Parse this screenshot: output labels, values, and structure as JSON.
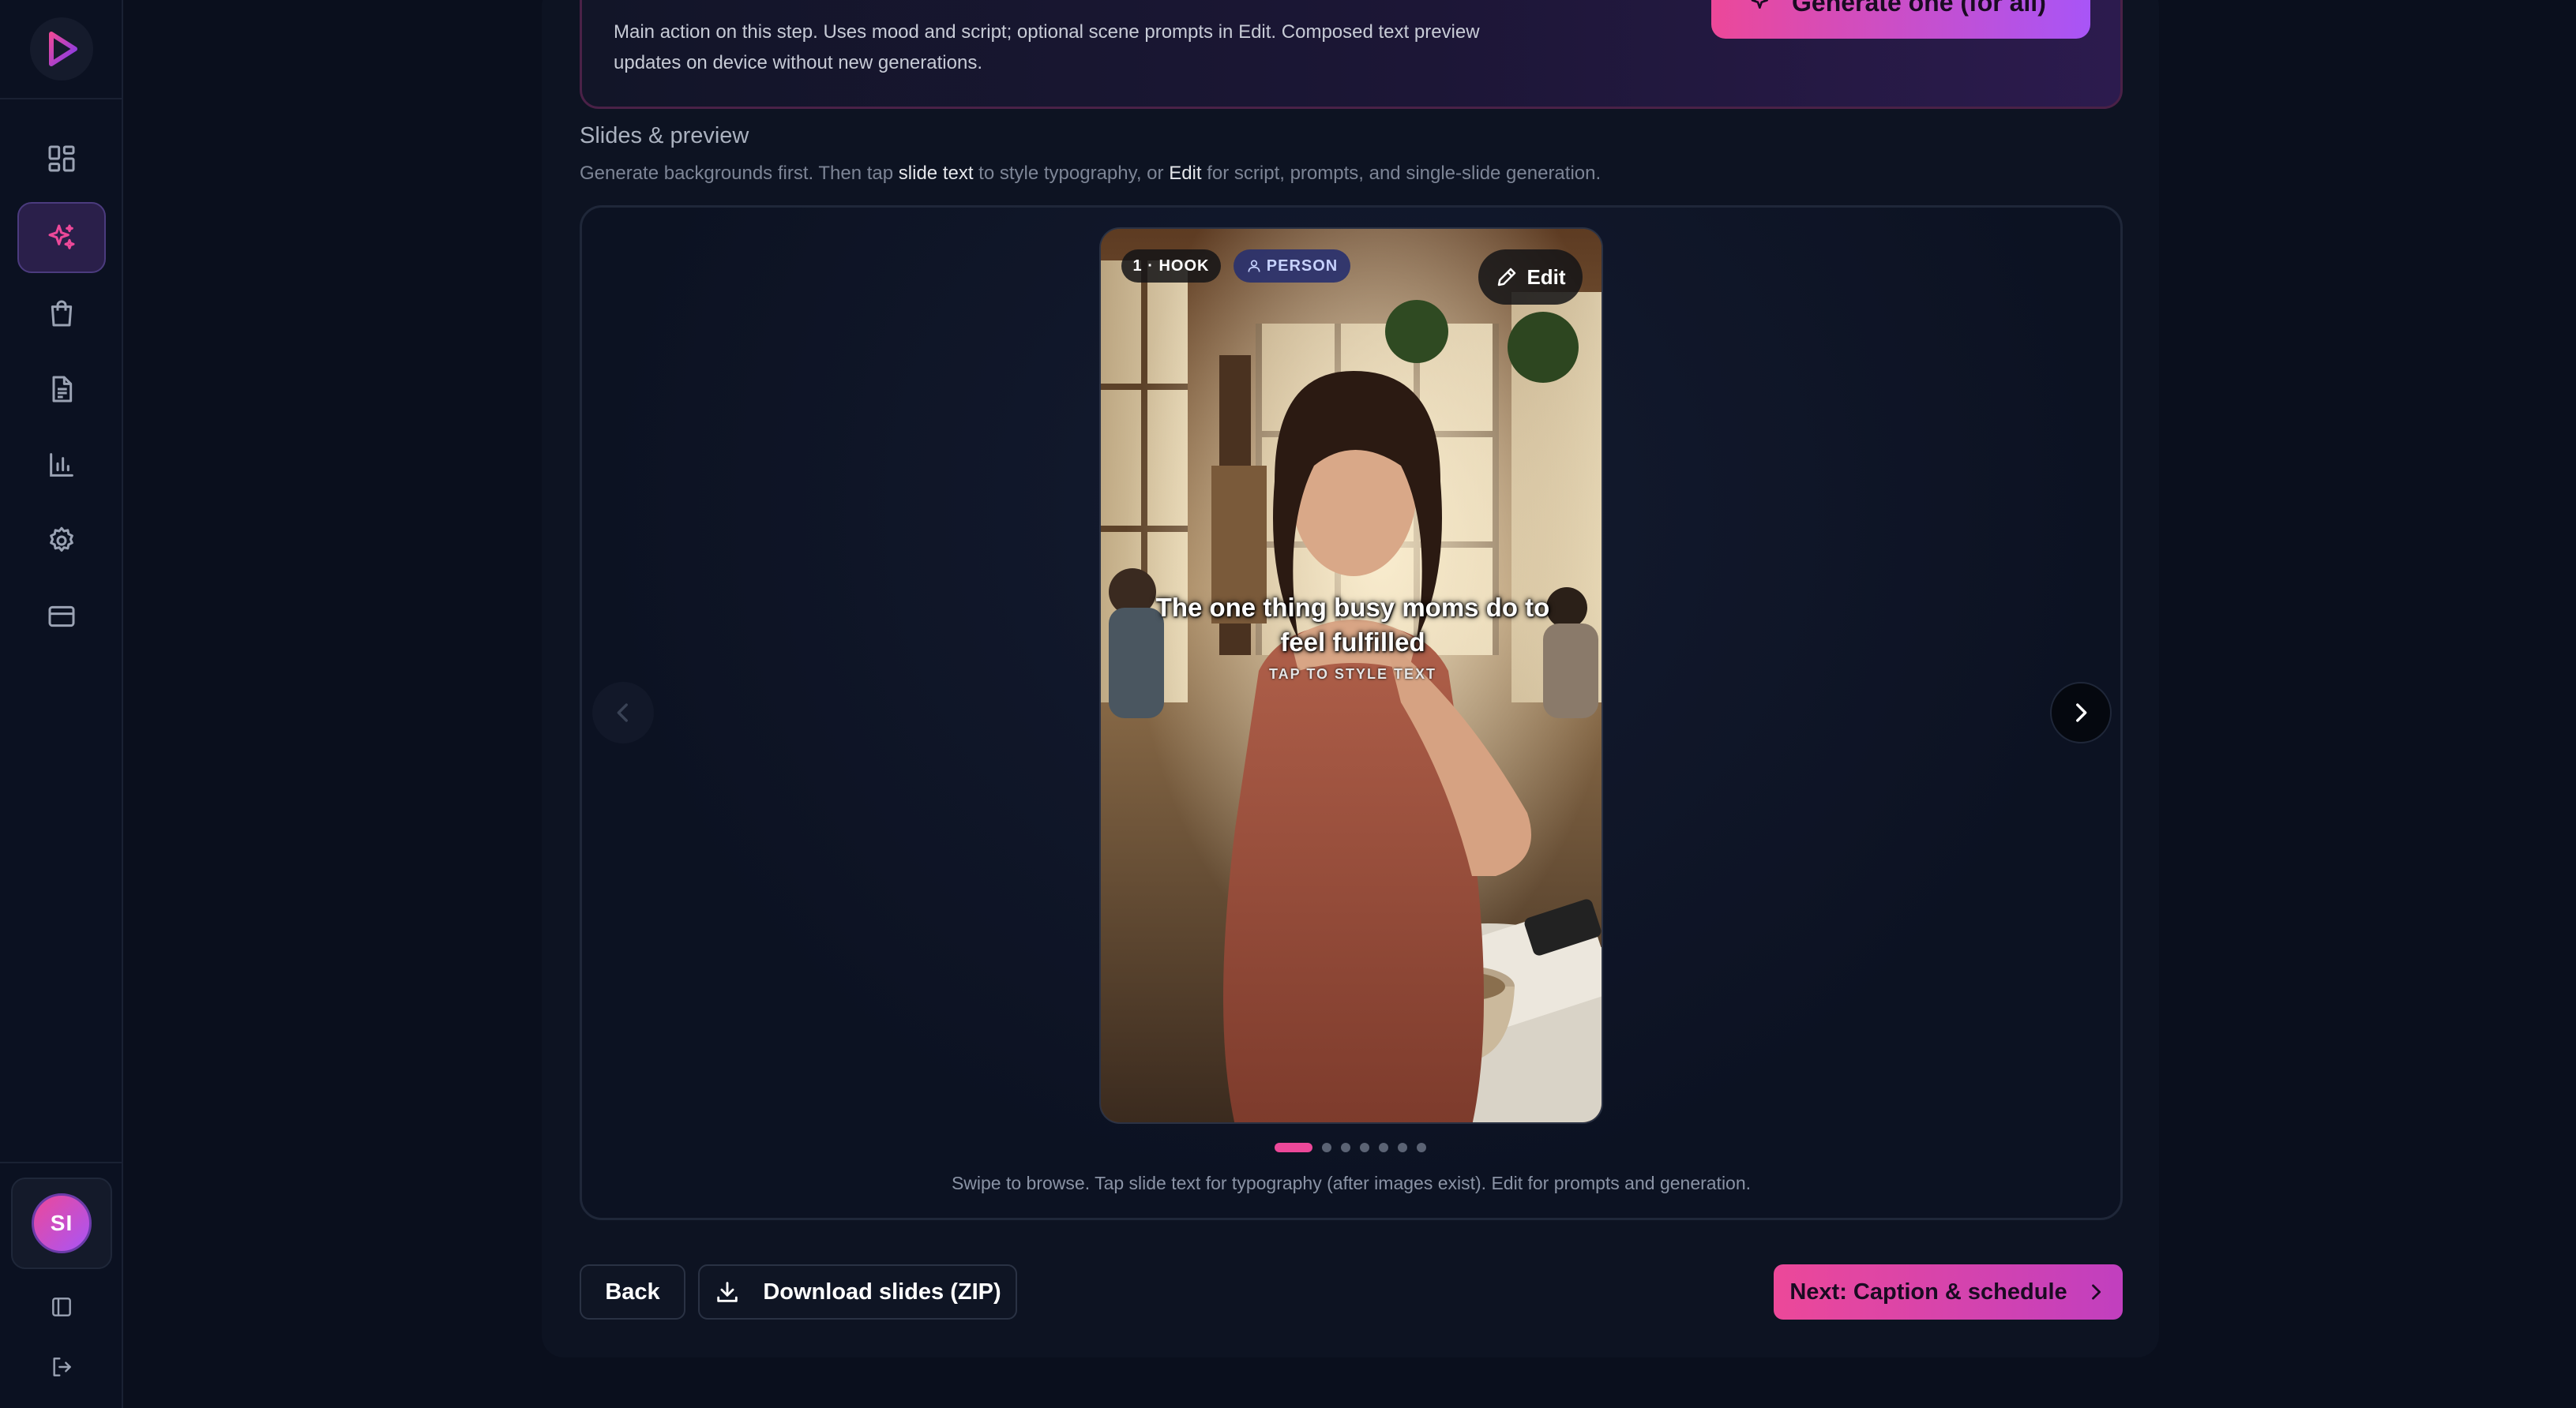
{
  "sidebar": {
    "avatar_initials": "SI",
    "nav": [
      {
        "name": "dashboard",
        "icon": "grid-icon"
      },
      {
        "name": "create",
        "icon": "sparkles-icon",
        "active": true
      },
      {
        "name": "products",
        "icon": "shopping-bag-icon"
      },
      {
        "name": "documents",
        "icon": "document-icon"
      },
      {
        "name": "analytics",
        "icon": "bar-chart-icon"
      },
      {
        "name": "settings",
        "icon": "gear-icon"
      },
      {
        "name": "billing",
        "icon": "credit-card-icon"
      }
    ]
  },
  "top_card": {
    "description": "Main action on this step. Uses mood and script; optional scene prompts in Edit. Composed text preview updates on device without new generations.",
    "generate_label": "Generate one (for all)"
  },
  "section": {
    "title": "Slides & preview",
    "subtitle_pre": "Generate backgrounds first. Then tap ",
    "subtitle_hl1": "slide text",
    "subtitle_mid": " to style typography, or ",
    "subtitle_hl2": "Edit",
    "subtitle_post": " for script, prompts, and single-slide generation."
  },
  "slide": {
    "index_badge": "1 · HOOK",
    "type_badge": "PERSON",
    "edit_label": "Edit",
    "text": "The one thing busy moms do to feel fulfilled",
    "hint": "TAP TO STYLE TEXT"
  },
  "carousel": {
    "total_slides": 7,
    "active_index": 0,
    "caption": "Swipe to browse. Tap slide text for typography (after images exist). Edit for prompts and generation."
  },
  "footer": {
    "back_label": "Back",
    "download_label": "Download slides (ZIP)",
    "next_label": "Next: Caption & schedule"
  },
  "colors": {
    "accent_pink": "#ec4899",
    "accent_purple": "#a855f7",
    "background": "#0a0f1d"
  }
}
